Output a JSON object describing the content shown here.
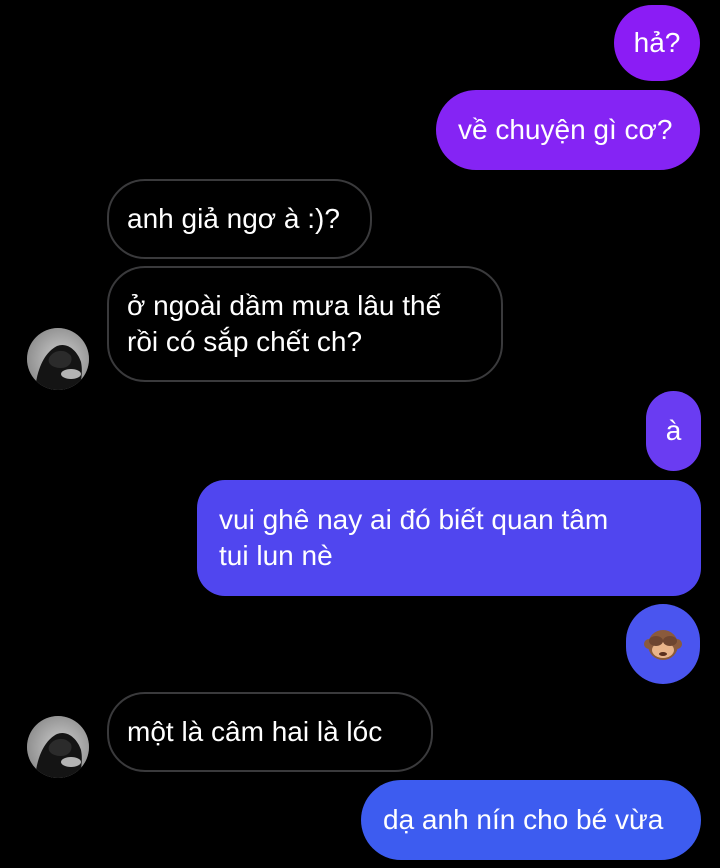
{
  "conversation": {
    "messages": [
      {
        "sender": "me",
        "text": "hả?"
      },
      {
        "sender": "me",
        "text": "về chuyện gì cơ?"
      },
      {
        "sender": "them",
        "text": "anh giả ngơ à :)?"
      },
      {
        "sender": "them",
        "text": "ở ngoài dầm mưa lâu thế\nrồi có sắp chết ch?"
      },
      {
        "sender": "me",
        "text": "à"
      },
      {
        "sender": "me",
        "text": "vui ghê nay ai đó biết quan tâm\ntui lun nè"
      },
      {
        "sender": "me",
        "emoji": "see-no-evil-monkey"
      },
      {
        "sender": "them",
        "text": "một là câm hai là lóc"
      },
      {
        "sender": "me",
        "text": "dạ anh nín cho bé vừa"
      }
    ]
  },
  "colors": {
    "background": "#000000",
    "outgoing_purple": "#8b1cf5",
    "outgoing_blue": "#4456ef",
    "incoming_border": "#3a3a3c",
    "text": "#ffffff"
  }
}
